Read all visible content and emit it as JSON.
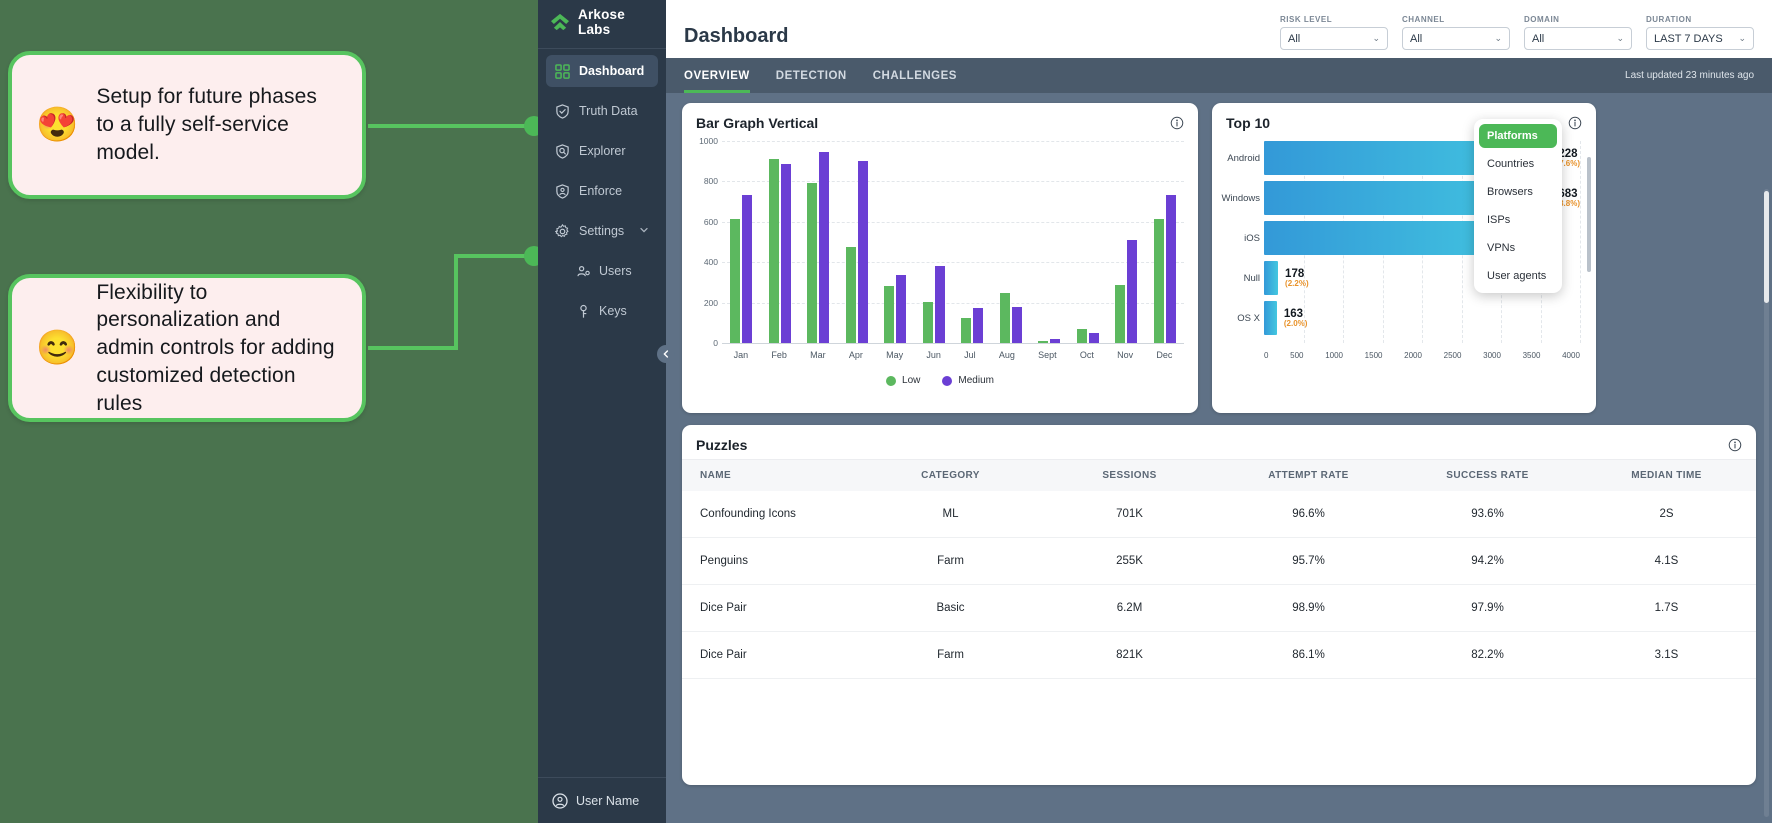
{
  "callouts": [
    {
      "emoji": "😍",
      "text": "Setup for future phases to a fully self-service model."
    },
    {
      "emoji": "😊",
      "text": "Flexibility to personalization and admin controls for adding customized detection rules"
    }
  ],
  "sidebar": {
    "brand": "Arkose Labs",
    "items": [
      {
        "label": "Dashboard",
        "icon": "grid-icon",
        "active": true
      },
      {
        "label": "Truth Data",
        "icon": "shield-check-icon",
        "active": false
      },
      {
        "label": "Explorer",
        "icon": "shield-search-icon",
        "active": false
      },
      {
        "label": "Enforce",
        "icon": "shield-user-icon",
        "active": false
      },
      {
        "label": "Settings",
        "icon": "gear-icon",
        "active": false
      }
    ],
    "sub_items": [
      {
        "label": "Users",
        "icon": "users-icon"
      },
      {
        "label": "Keys",
        "icon": "key-icon"
      }
    ],
    "footer_user": "User Name"
  },
  "header": {
    "title": "Dashboard",
    "filters": [
      {
        "label": "RISK LEVEL",
        "value": "All"
      },
      {
        "label": "CHANNEL",
        "value": "All"
      },
      {
        "label": "DOMAIN",
        "value": "All"
      },
      {
        "label": "DURATION",
        "value": "LAST 7 DAYS"
      }
    ]
  },
  "tabs": {
    "items": [
      {
        "label": "OVERVIEW",
        "active": true
      },
      {
        "label": "DETECTION",
        "active": false
      },
      {
        "label": "CHALLENGES",
        "active": false
      }
    ],
    "updated": "Last updated 23 minutes ago"
  },
  "bar_card": {
    "title": "Bar Graph Vertical"
  },
  "top10_card": {
    "title": "Top 10",
    "dropdown": {
      "items": [
        "Platforms",
        "Countries",
        "Browsers",
        "ISPs",
        "VPNs",
        "User agents"
      ],
      "selected": "Platforms"
    }
  },
  "puzzles": {
    "title": "Puzzles",
    "columns": [
      "NAME",
      "CATEGORY",
      "SESSIONS",
      "ATTEMPT RATE",
      "SUCCESS RATE",
      "MEDIAN TIME"
    ],
    "rows": [
      [
        "Confounding Icons",
        "ML",
        "701K",
        "96.6%",
        "93.6%",
        "2S"
      ],
      [
        "Penguins",
        "Farm",
        "255K",
        "95.7%",
        "94.2%",
        "4.1S"
      ],
      [
        "Dice Pair",
        "Basic",
        "6.2M",
        "98.9%",
        "97.9%",
        "1.7S"
      ],
      [
        "Dice Pair",
        "Farm",
        "821K",
        "86.1%",
        "82.2%",
        "3.1S"
      ]
    ]
  },
  "colors": {
    "accent_green": "#4cb857",
    "low_series": "#5cb85f",
    "medium_series": "#6b3fd4",
    "sidebar_bg": "#2b3948",
    "app_bg": "#5f7186",
    "canvas_bg": "#4a734e",
    "callout_bg": "#fdeeee",
    "percent_orange": "#e8922a",
    "bar_gradient_start": "#3399d8",
    "bar_gradient_end": "#43c7e0"
  },
  "chart_data": [
    {
      "type": "bar",
      "title": "Bar Graph Vertical",
      "categories": [
        "Jan",
        "Feb",
        "Mar",
        "Apr",
        "May",
        "Jun",
        "Jul",
        "Aug",
        "Sept",
        "Oct",
        "Nov",
        "Dec"
      ],
      "series": [
        {
          "name": "Low",
          "color": "#5cb85f",
          "values": [
            615,
            912,
            790,
            473,
            280,
            203,
            125,
            248,
            8,
            70,
            285,
            615
          ]
        },
        {
          "name": "Medium",
          "color": "#6b3fd4",
          "values": [
            733,
            887,
            947,
            900,
            338,
            383,
            172,
            178,
            22,
            50,
            512,
            733
          ]
        }
      ],
      "xlabel": "",
      "ylabel": "",
      "ylim": [
        0,
        1000
      ],
      "yticks": [
        0,
        200,
        400,
        600,
        800,
        1000
      ],
      "grid": true,
      "legend_position": "bottom"
    },
    {
      "type": "bar",
      "orientation": "horizontal",
      "title": "Top 10",
      "categories": [
        "Android",
        "Windows",
        "iOS",
        "Null",
        "OS X"
      ],
      "values": [
        4228,
        3683,
        3400,
        178,
        163
      ],
      "labels": [
        "4228",
        "3683",
        "",
        "178",
        "163"
      ],
      "percents": [
        "(27.6%)",
        "(23.8%)",
        "",
        "(2.2%)",
        "(2.0%)"
      ],
      "xlim": [
        0,
        4000
      ],
      "xticks": [
        0,
        500,
        1000,
        1500,
        2000,
        2500,
        3000,
        3500,
        4000
      ],
      "grid": true,
      "legend_position": "none"
    }
  ]
}
